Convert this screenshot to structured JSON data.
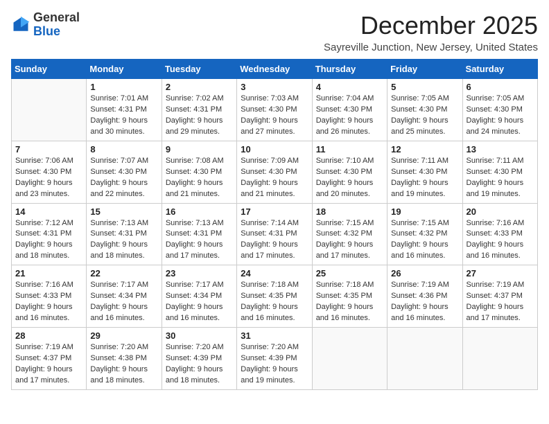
{
  "header": {
    "logo_general": "General",
    "logo_blue": "Blue",
    "month_title": "December 2025",
    "location": "Sayreville Junction, New Jersey, United States"
  },
  "calendar": {
    "days_of_week": [
      "Sunday",
      "Monday",
      "Tuesday",
      "Wednesday",
      "Thursday",
      "Friday",
      "Saturday"
    ],
    "weeks": [
      [
        {
          "day": "",
          "info": ""
        },
        {
          "day": "1",
          "info": "Sunrise: 7:01 AM\nSunset: 4:31 PM\nDaylight: 9 hours\nand 30 minutes."
        },
        {
          "day": "2",
          "info": "Sunrise: 7:02 AM\nSunset: 4:31 PM\nDaylight: 9 hours\nand 29 minutes."
        },
        {
          "day": "3",
          "info": "Sunrise: 7:03 AM\nSunset: 4:30 PM\nDaylight: 9 hours\nand 27 minutes."
        },
        {
          "day": "4",
          "info": "Sunrise: 7:04 AM\nSunset: 4:30 PM\nDaylight: 9 hours\nand 26 minutes."
        },
        {
          "day": "5",
          "info": "Sunrise: 7:05 AM\nSunset: 4:30 PM\nDaylight: 9 hours\nand 25 minutes."
        },
        {
          "day": "6",
          "info": "Sunrise: 7:05 AM\nSunset: 4:30 PM\nDaylight: 9 hours\nand 24 minutes."
        }
      ],
      [
        {
          "day": "7",
          "info": "Sunrise: 7:06 AM\nSunset: 4:30 PM\nDaylight: 9 hours\nand 23 minutes."
        },
        {
          "day": "8",
          "info": "Sunrise: 7:07 AM\nSunset: 4:30 PM\nDaylight: 9 hours\nand 22 minutes."
        },
        {
          "day": "9",
          "info": "Sunrise: 7:08 AM\nSunset: 4:30 PM\nDaylight: 9 hours\nand 21 minutes."
        },
        {
          "day": "10",
          "info": "Sunrise: 7:09 AM\nSunset: 4:30 PM\nDaylight: 9 hours\nand 21 minutes."
        },
        {
          "day": "11",
          "info": "Sunrise: 7:10 AM\nSunset: 4:30 PM\nDaylight: 9 hours\nand 20 minutes."
        },
        {
          "day": "12",
          "info": "Sunrise: 7:11 AM\nSunset: 4:30 PM\nDaylight: 9 hours\nand 19 minutes."
        },
        {
          "day": "13",
          "info": "Sunrise: 7:11 AM\nSunset: 4:30 PM\nDaylight: 9 hours\nand 19 minutes."
        }
      ],
      [
        {
          "day": "14",
          "info": "Sunrise: 7:12 AM\nSunset: 4:31 PM\nDaylight: 9 hours\nand 18 minutes."
        },
        {
          "day": "15",
          "info": "Sunrise: 7:13 AM\nSunset: 4:31 PM\nDaylight: 9 hours\nand 18 minutes."
        },
        {
          "day": "16",
          "info": "Sunrise: 7:13 AM\nSunset: 4:31 PM\nDaylight: 9 hours\nand 17 minutes."
        },
        {
          "day": "17",
          "info": "Sunrise: 7:14 AM\nSunset: 4:31 PM\nDaylight: 9 hours\nand 17 minutes."
        },
        {
          "day": "18",
          "info": "Sunrise: 7:15 AM\nSunset: 4:32 PM\nDaylight: 9 hours\nand 17 minutes."
        },
        {
          "day": "19",
          "info": "Sunrise: 7:15 AM\nSunset: 4:32 PM\nDaylight: 9 hours\nand 16 minutes."
        },
        {
          "day": "20",
          "info": "Sunrise: 7:16 AM\nSunset: 4:33 PM\nDaylight: 9 hours\nand 16 minutes."
        }
      ],
      [
        {
          "day": "21",
          "info": "Sunrise: 7:16 AM\nSunset: 4:33 PM\nDaylight: 9 hours\nand 16 minutes."
        },
        {
          "day": "22",
          "info": "Sunrise: 7:17 AM\nSunset: 4:34 PM\nDaylight: 9 hours\nand 16 minutes."
        },
        {
          "day": "23",
          "info": "Sunrise: 7:17 AM\nSunset: 4:34 PM\nDaylight: 9 hours\nand 16 minutes."
        },
        {
          "day": "24",
          "info": "Sunrise: 7:18 AM\nSunset: 4:35 PM\nDaylight: 9 hours\nand 16 minutes."
        },
        {
          "day": "25",
          "info": "Sunrise: 7:18 AM\nSunset: 4:35 PM\nDaylight: 9 hours\nand 16 minutes."
        },
        {
          "day": "26",
          "info": "Sunrise: 7:19 AM\nSunset: 4:36 PM\nDaylight: 9 hours\nand 16 minutes."
        },
        {
          "day": "27",
          "info": "Sunrise: 7:19 AM\nSunset: 4:37 PM\nDaylight: 9 hours\nand 17 minutes."
        }
      ],
      [
        {
          "day": "28",
          "info": "Sunrise: 7:19 AM\nSunset: 4:37 PM\nDaylight: 9 hours\nand 17 minutes."
        },
        {
          "day": "29",
          "info": "Sunrise: 7:20 AM\nSunset: 4:38 PM\nDaylight: 9 hours\nand 18 minutes."
        },
        {
          "day": "30",
          "info": "Sunrise: 7:20 AM\nSunset: 4:39 PM\nDaylight: 9 hours\nand 18 minutes."
        },
        {
          "day": "31",
          "info": "Sunrise: 7:20 AM\nSunset: 4:39 PM\nDaylight: 9 hours\nand 19 minutes."
        },
        {
          "day": "",
          "info": ""
        },
        {
          "day": "",
          "info": ""
        },
        {
          "day": "",
          "info": ""
        }
      ]
    ]
  }
}
